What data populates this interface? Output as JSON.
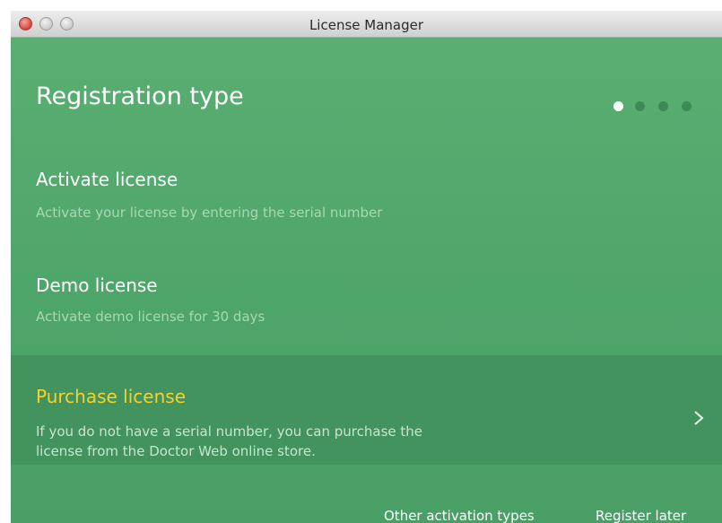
{
  "window": {
    "title": "License Manager"
  },
  "page": {
    "heading": "Registration type",
    "step_indicator": {
      "total": 4,
      "current": 1
    }
  },
  "options": {
    "activate": {
      "title": "Activate license",
      "description": "Activate your license by entering the serial number"
    },
    "demo": {
      "title": "Demo license",
      "description": "Activate demo license for 30 days"
    },
    "purchase": {
      "title": "Purchase license",
      "description_line1": "If you do not have a serial number, you can purchase the",
      "description_line2": "license from the Doctor Web online store.",
      "chevron_icon": "chevron-right-icon"
    }
  },
  "footer": {
    "other_activation": "Other activation types",
    "register_later": "Register later"
  },
  "colors": {
    "background": "#4ea76c",
    "selected_background": "#43935f",
    "selected_title": "#f4d22c",
    "description": "#a8d8b1"
  }
}
